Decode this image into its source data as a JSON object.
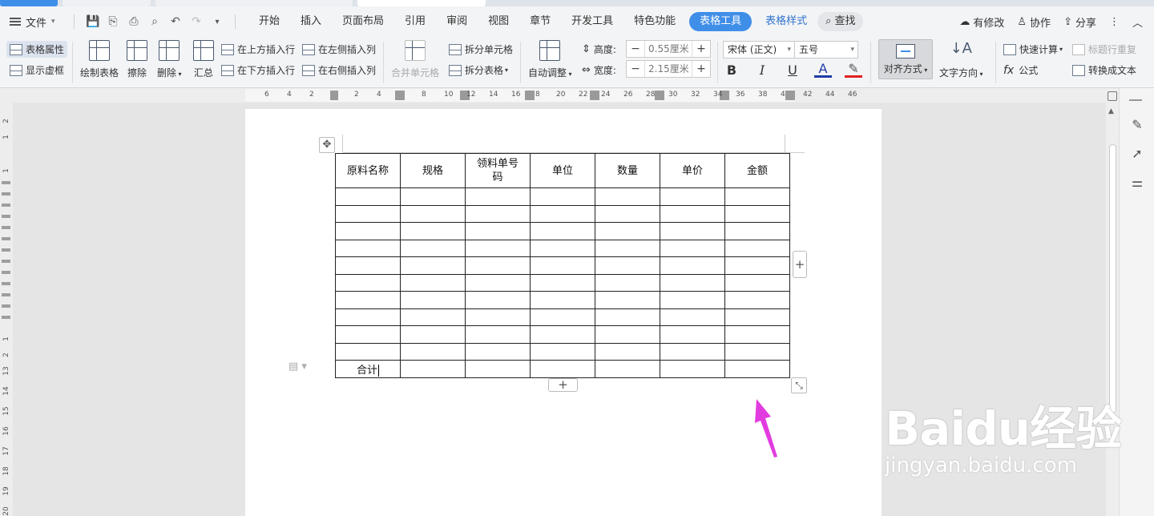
{
  "menu": {
    "file_label": "文件",
    "tabs": [
      {
        "label": "开始"
      },
      {
        "label": "插入"
      },
      {
        "label": "页面布局"
      },
      {
        "label": "引用"
      },
      {
        "label": "审阅"
      },
      {
        "label": "视图"
      },
      {
        "label": "章节"
      },
      {
        "label": "开发工具"
      },
      {
        "label": "特色功能"
      }
    ],
    "active_tab": "表格工具",
    "style_tab": "表格样式",
    "search_label": "查找",
    "right": {
      "changes": "有修改",
      "collab": "协作",
      "share": "分享"
    }
  },
  "ribbon": {
    "table_props": "表格属性",
    "show_gridlines": "显示虚框",
    "draw_table": "绘制表格",
    "erase": "擦除",
    "delete": "删除",
    "summary": "汇总",
    "insert_above": "在上方插入行",
    "insert_below": "在下方插入行",
    "insert_left": "在左侧插入列",
    "insert_right": "在右侧插入列",
    "merge_cells": "合并单元格",
    "split_cells": "拆分单元格",
    "split_table": "拆分表格",
    "auto_fit": "自动调整",
    "height_label": "高度:",
    "height_value": "0.55厘米",
    "width_label": "宽度:",
    "width_value": "2.15厘米",
    "font_name": "宋体 (正文)",
    "font_size": "五号",
    "align": "对齐方式",
    "text_direction": "文字方向",
    "quick_calc": "快速计算",
    "title_repeat": "标题行重复",
    "formula": "公式",
    "to_text": "转换成文本"
  },
  "ruler": {
    "h_marks": [
      "6",
      "4",
      "2",
      "2",
      "4",
      "8",
      "10",
      "12",
      "14",
      "16",
      "8",
      "20",
      "22",
      "24",
      "26",
      "28",
      "30",
      "32",
      "34",
      "36",
      "38",
      "4",
      "42",
      "44",
      "46"
    ],
    "v_marks": [
      "2",
      "1",
      "1",
      "1",
      "2",
      "13",
      "14",
      "15",
      "16",
      "17",
      "18",
      "19",
      "20",
      "21"
    ]
  },
  "table": {
    "headers": [
      "原料名称",
      "规格",
      "领料单号码",
      "单位",
      "数量",
      "单价",
      "金额"
    ],
    "empty_rows": 10,
    "footer_label": "合计"
  },
  "colors": {
    "accent": "#3f8ee8",
    "arrow": "#e23be0"
  },
  "watermark": {
    "logo": "Baidu经验",
    "url": "jingyan.baidu.com"
  }
}
